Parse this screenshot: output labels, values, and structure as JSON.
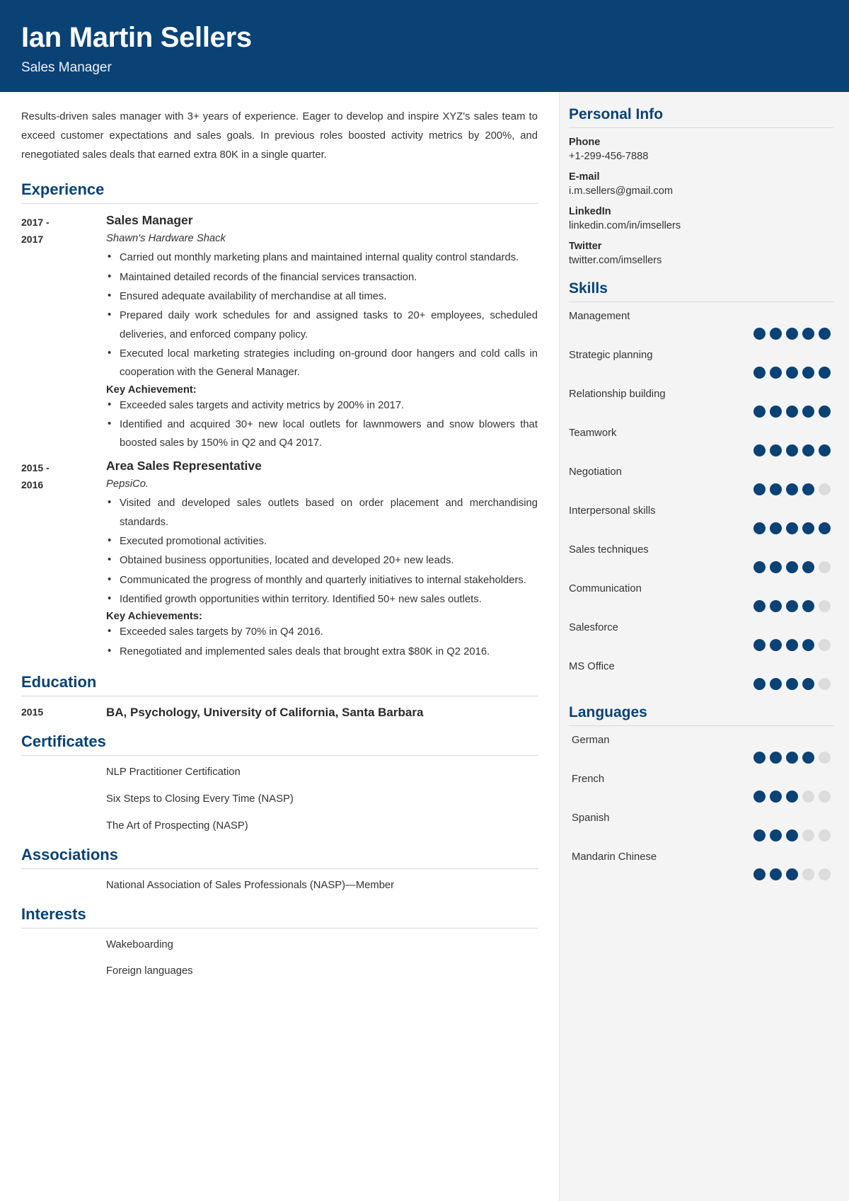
{
  "theme": {
    "accent": "#0a4275",
    "sidebar_bg": "#f4f4f4",
    "dot_on": "#0a4275",
    "dot_off": "#dcdcdc"
  },
  "header": {
    "name": "Ian Martin Sellers",
    "job_title": "Sales Manager"
  },
  "summary": "Results-driven sales manager with 3+ years of experience. Eager to develop and inspire XYZ's sales team to exceed customer expectations and sales goals. In previous roles boosted activity metrics by 200%, and renegotiated sales deals that earned extra 80K in a single quarter.",
  "sections": {
    "experience_heading": "Experience",
    "education_heading": "Education",
    "certificates_heading": "Certificates",
    "associations_heading": "Associations",
    "interests_heading": "Interests"
  },
  "experience": [
    {
      "dates": "2017 - 2017",
      "role": "Sales Manager",
      "organization": "Shawn's Hardware Shack",
      "bullets": [
        "Carried out monthly marketing plans and maintained internal quality control standards.",
        "Maintained detailed records of the financial services transaction.",
        "Ensured adequate availability of merchandise at all times.",
        "Prepared daily work schedules for and assigned tasks to 20+ employees, scheduled deliveries, and enforced company policy.",
        "Executed local marketing strategies including on-ground door hangers and cold calls in cooperation with the General Manager."
      ],
      "achievements_label": "Key Achievement:",
      "achievements": [
        "Exceeded sales targets and activity metrics by 200% in 2017.",
        "Identified and acquired 30+ new local outlets for lawnmowers and snow blowers that boosted sales by 150% in Q2 and Q4 2017."
      ]
    },
    {
      "dates": "2015 - 2016",
      "role": "Area Sales Representative",
      "organization": "PepsiCo.",
      "bullets": [
        "Visited and developed sales outlets based on order placement and merchandising standards.",
        "Executed promotional activities.",
        "Obtained business opportunities, located and developed 20+ new leads.",
        "Communicated the progress of monthly and quarterly initiatives to internal stakeholders.",
        "Identified growth opportunities within territory. Identified 50+ new sales outlets."
      ],
      "achievements_label": "Key Achievements:",
      "achievements": [
        "Exceeded sales targets by 70% in Q4 2016.",
        "Renegotiated and implemented sales deals that brought extra $80K in Q2 2016."
      ]
    }
  ],
  "education": [
    {
      "year": "2015",
      "degree": "BA, Psychology, University of California, Santa Barbara"
    }
  ],
  "certificates": [
    "NLP Practitioner Certification",
    "Six Steps to Closing Every Time (NASP)",
    "The Art of Prospecting (NASP)"
  ],
  "associations": [
    "National Association of Sales Professionals (NASP)—Member"
  ],
  "interests": [
    "Wakeboarding",
    "Foreign languages"
  ],
  "sidebar": {
    "personal_info_heading": "Personal Info",
    "contacts": [
      {
        "label": "Phone",
        "value": "+1-299-456-7888"
      },
      {
        "label": "E-mail",
        "value": "i.m.sellers@gmail.com"
      },
      {
        "label": "LinkedIn",
        "value": "linkedin.com/in/imsellers"
      },
      {
        "label": "Twitter",
        "value": "twitter.com/imsellers"
      }
    ],
    "skills_heading": "Skills",
    "skills": [
      {
        "label": "Management",
        "rating": 5,
        "max": 5
      },
      {
        "label": "Strategic planning",
        "rating": 5,
        "max": 5
      },
      {
        "label": "Relationship building",
        "rating": 5,
        "max": 5
      },
      {
        "label": "Teamwork",
        "rating": 5,
        "max": 5
      },
      {
        "label": "Negotiation",
        "rating": 4,
        "max": 5
      },
      {
        "label": "Interpersonal skills",
        "rating": 5,
        "max": 5
      },
      {
        "label": "Sales techniques",
        "rating": 4,
        "max": 5
      },
      {
        "label": "Communication",
        "rating": 4,
        "max": 5
      },
      {
        "label": "Salesforce",
        "rating": 4,
        "max": 5
      },
      {
        "label": "MS Office",
        "rating": 4,
        "max": 5
      }
    ],
    "languages_heading": "Languages",
    "languages": [
      {
        "label": "German",
        "rating": 4,
        "max": 5
      },
      {
        "label": "French",
        "rating": 3,
        "max": 5
      },
      {
        "label": "Spanish",
        "rating": 3,
        "max": 5
      },
      {
        "label": "Mandarin Chinese",
        "rating": 3,
        "max": 5
      }
    ]
  }
}
